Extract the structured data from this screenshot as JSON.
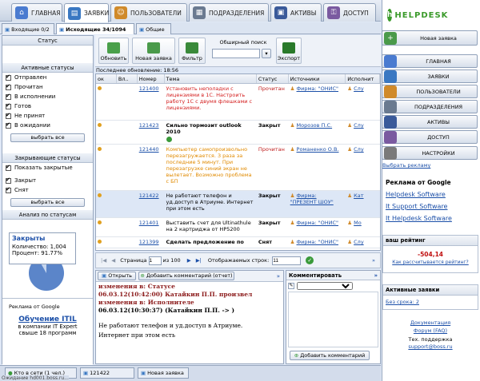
{
  "main_tabs": [
    {
      "label": "ГЛАВНАЯ",
      "icon": "home-icon",
      "color": "#4a7bd0"
    },
    {
      "label": "ЗАЯВКИ",
      "icon": "tickets-icon",
      "color": "#3a78c2"
    },
    {
      "label": "ПОЛЬЗОВАТЕЛИ",
      "icon": "users-icon",
      "color": "#d08a2a"
    },
    {
      "label": "ПОДРАЗДЕЛЕНИЯ",
      "icon": "departments-icon",
      "color": "#6a7a90"
    },
    {
      "label": "АКТИВЫ",
      "icon": "assets-icon",
      "color": "#3a5a9a"
    },
    {
      "label": "ДОСТУП",
      "icon": "access-icon",
      "color": "#7a5aa0"
    }
  ],
  "sub_tabs": [
    {
      "label": "Входящие 0/2"
    },
    {
      "label": "Исходящие 34/1094"
    },
    {
      "label": "Общие"
    }
  ],
  "left": {
    "status_head": "Статус",
    "active_head": "Активные статусы",
    "active": [
      {
        "label": "Отправлен",
        "checked": true
      },
      {
        "label": "Прочитан",
        "checked": true
      },
      {
        "label": "В исполнении",
        "checked": true
      },
      {
        "label": "Готов",
        "checked": true
      },
      {
        "label": "Не принят",
        "checked": true
      },
      {
        "label": "В ожидании",
        "checked": true
      }
    ],
    "select_all": "выбрать все",
    "closing_head": "Закрывающие статусы",
    "show_closed": "Показать закрытые",
    "closing": [
      {
        "label": "Закрыт",
        "checked": true
      },
      {
        "label": "Снят",
        "checked": true
      }
    ],
    "select_all2": "выбрать все",
    "analysis_head": "Анализ по статусам",
    "tooltip_title": "Закрыты",
    "tooltip_count": "Количество: 1,004",
    "tooltip_percent": "Процент: 91.77%",
    "pie_fraction": 0.9177,
    "ad_title": "Реклама от Google",
    "ad_link": "Обучение ITIL",
    "ad_text": "в компании IT Expert свыше 18 программ"
  },
  "toolbar": {
    "refresh": "Обновить",
    "new_ticket": "Новая заявка",
    "filter": "Фильтр",
    "search_label": "Обширный поиск",
    "search_value": "",
    "export": "Экспорт",
    "last_update": "Последнее обновление: 18:56"
  },
  "grid": {
    "columns": [
      "ок",
      "Вл..",
      "Номер",
      "Тема",
      "Статус",
      "Источники",
      "Исполнит"
    ],
    "rows": [
      {
        "num": "121400",
        "subject": "Установить неполадки с лицензиями в 1С. Настроить работу 1С с двумя флешками с лицензиями.",
        "status": "Прочитан",
        "source": "Фирма: \"ОНИС\"",
        "exec": "Слу",
        "color": "#d42020",
        "bold": false
      },
      {
        "num": "121423",
        "subject": "Сильно тормозит outlook 2010",
        "status": "Закрыт",
        "source": "Морозов П.С.",
        "exec": "Слу",
        "color": "#000000",
        "bold": true
      },
      {
        "num": "121440",
        "subject": "Компьютер самопроизвольно перезагружается. 3 раза за последние 5 минут. При перезагрузке синий экран не вылетает. Возможно проблема с БП",
        "status": "Прочитан",
        "source": "Романенко О.В.",
        "exec": "Слу",
        "color": "#e08a00",
        "bold": false
      },
      {
        "num": "121422",
        "subject": "Не работают телефон и уд.доступ в Атриуме. Интернет при этом есть",
        "status": "Закрыт",
        "source": "Фирма: \"ПРЕЗЕНТ ШОУ\"",
        "exec": "Кат",
        "color": "#000000",
        "bold": false
      },
      {
        "num": "121401",
        "subject": "Выставить счет для Ultinathule на 2 картриджа от HP5200",
        "status": "Закрыт",
        "source": "Фирма: \"ОНИС\"",
        "exec": "Мо",
        "color": "#000000",
        "bold": false
      },
      {
        "num": "121399",
        "subject": "Сделать предложение по",
        "status": "Снят",
        "source": "Фирма: \"ОНИС\"",
        "exec": "Слу",
        "color": "#000000",
        "bold": true
      }
    ]
  },
  "pager": {
    "page_label": "Страница",
    "page": "1",
    "of": "из 100",
    "rows_label": "Отображаемых строк:",
    "rows": "11"
  },
  "detail": {
    "open": "Открыть",
    "add_comment": "Добавить комментарий (отчет)",
    "lines": [
      {
        "text": "изменения в: Статусе",
        "color": "#8b1a1a"
      },
      {
        "text": "06.03.12(10:42:00) Катайкин П.П. произвел",
        "color": "#8b1a1a"
      },
      {
        "text": "изменения в: Исполнителе",
        "color": "#8b1a1a"
      },
      {
        "text": "06.03.12(10:30:37) (Катайкин П.П. -> )",
        "color": "#000000"
      }
    ],
    "body1": "Не работают телефон и уд.доступ в Атриуме.",
    "body2": "Интернет при этом есть"
  },
  "comments": {
    "title": "Комментировать",
    "add": "Добавить комментарий"
  },
  "right": {
    "logo": "HELPDESK",
    "new_ticket": "Новая заявка",
    "nav": [
      {
        "label": "ГЛАВНАЯ",
        "icon": "home-icon",
        "color": "#4a7bd0"
      },
      {
        "label": "ЗАЯВКИ",
        "icon": "tickets-icon",
        "color": "#3a78c2"
      },
      {
        "label": "ПОЛЬЗОВАТЕЛИ",
        "icon": "users-icon",
        "color": "#d08a2a"
      },
      {
        "label": "ПОДРАЗДЕЛЕНИЯ",
        "icon": "departments-icon",
        "color": "#6a7a90"
      },
      {
        "label": "АКТИВЫ",
        "icon": "assets-icon",
        "color": "#3a5a9a"
      },
      {
        "label": "ДОСТУП",
        "icon": "access-icon",
        "color": "#7a5aa0"
      },
      {
        "label": "НАСТРОЙКИ",
        "icon": "settings-icon",
        "color": "#7a7a7a"
      }
    ],
    "choose_ad": "Выбрать рекламу",
    "ad_title": "Реклама от Google",
    "ads": [
      "Helpdesk Software",
      "It Support Software",
      "It Helpdesk Software"
    ],
    "rating_head": "ваш рейтинг",
    "rating": "-504,14",
    "rating_link": "Как рассчитывается рейтинг?",
    "active_head": "Активные заявки",
    "no_deadline": "Без срока: 2",
    "doc": "Документация",
    "faq": "Форум (FAQ)",
    "support": "Тех. поддержка",
    "email": "support@boss.ru"
  },
  "bottom": {
    "tabs": [
      "Кто в сети (1 чел.)",
      "121422",
      "Новая заявка"
    ],
    "status": "Ожидание hd001.boss.ru..."
  }
}
